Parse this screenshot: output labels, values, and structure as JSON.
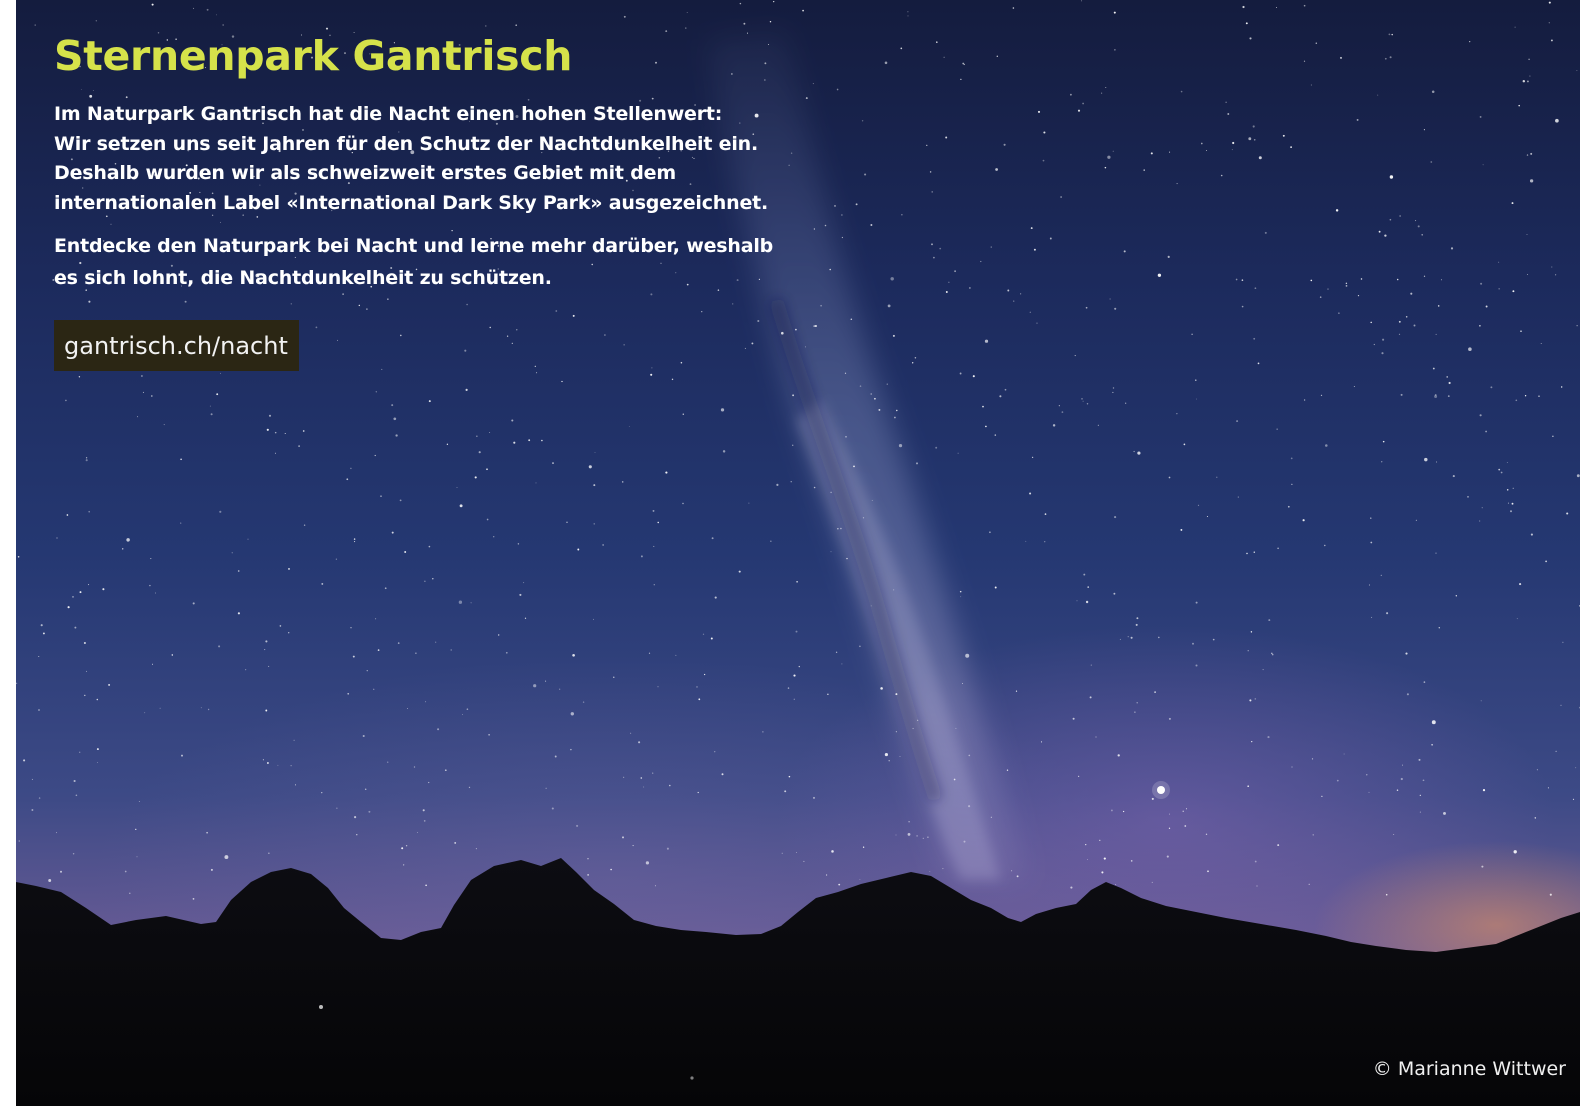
{
  "page": {
    "title": "Sternenpark Gantrisch",
    "paragraph_1": "Im Naturpark Gantrisch hat die Nacht einen hohen Stellenwert: Wir setzen uns seit Jahren für den Schutz der Nachtdunkelheit ein. Deshalb wurden wir als schweizweit erstes Gebiet mit dem internationalen Label «International Dark Sky Park» ausgezeichnet.",
    "paragraph_1_lines": [
      "Im Naturpark Gantrisch hat die Nacht einen hohen Stellenwert:",
      "Wir setzen uns seit Jahren für den Schutz der Nachtdunkelheit ein.",
      "Deshalb wurden wir als schweizweit erstes Gebiet mit dem",
      "internationalen Label «International Dark Sky Park» ausgezeichnet."
    ],
    "paragraph_2_lines": [
      "Entdecke den Naturpark bei Nacht und lerne mehr darüber, weshalb",
      "es sich lohnt, die Nachtdunkelheit zu schützen."
    ],
    "link_text": "gantrisch.ch/nacht",
    "photo_credit": "© Marianne Wittwer"
  },
  "colors": {
    "title": "#d6e24a",
    "body_text": "#ffffff",
    "link_background": "#2b2614",
    "link_text": "#f2f2f2",
    "sky_top": "#141c3e",
    "sky_horizon": "#7a6494",
    "sunset_glow": "#e89660",
    "mountains": "#0a0a0e"
  }
}
